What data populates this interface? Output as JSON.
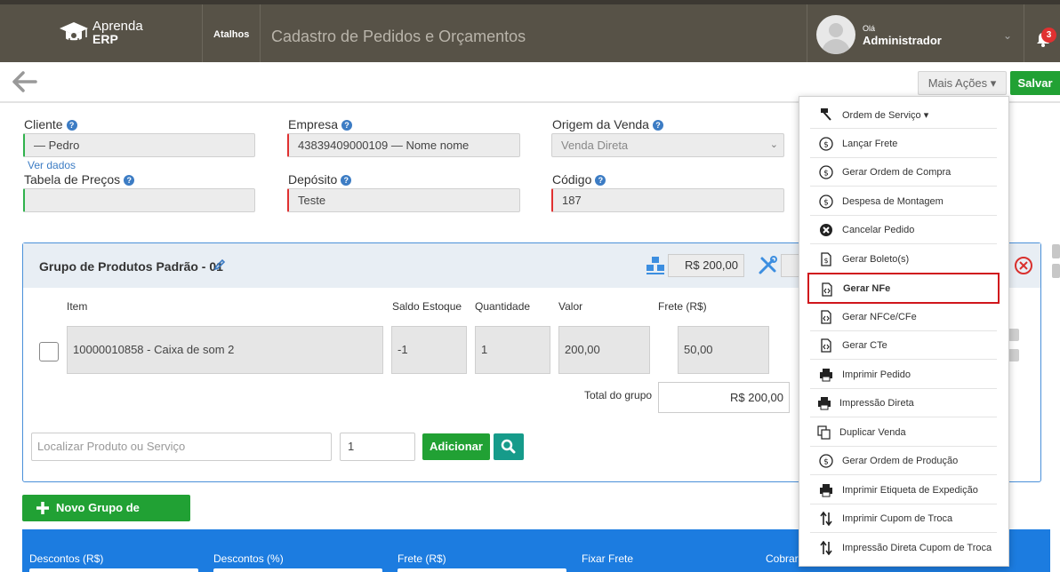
{
  "header": {
    "logo_line1": "Aprenda",
    "logo_line2": "ERP",
    "shortcuts": "Atalhos",
    "title": "Cadastro de Pedidos e Orçamentos",
    "greeting": "Olá",
    "user_name": "Administrador",
    "notifications": "3"
  },
  "actions": {
    "more": "Mais Ações ▾",
    "save": "Salvar"
  },
  "form": {
    "cliente_label": "Cliente",
    "cliente_value": "— Pedro",
    "ver_dados": "Ver dados",
    "empresa_label": "Empresa",
    "empresa_value": "43839409000109 — Nome nome",
    "origem_label": "Origem da Venda",
    "origem_value": "Venda Direta",
    "tabela_label": "Tabela de Preços",
    "tabela_value": "",
    "deposito_label": "Depósito",
    "deposito_value": "Teste",
    "codigo_label": "Código",
    "codigo_value": "187"
  },
  "group": {
    "title": "Grupo de Produtos Padrão - 01",
    "total_badge": "R$ 200,00",
    "columns": {
      "item": "Item",
      "stock": "Saldo Estoque",
      "qty": "Quantidade",
      "value": "Valor",
      "freight": "Frete (R$)"
    },
    "row": {
      "item": "10000010858 - Caixa de som 2",
      "stock": "-1",
      "qty": "1",
      "value": "200,00",
      "freight": "50,00"
    },
    "total_label": "Total do grupo",
    "total_value": "R$ 200,00",
    "search_placeholder": "Localizar Produto ou Serviço",
    "search_qty": "1",
    "add_button": "Adicionar"
  },
  "new_group_button": "Novo Grupo de Produtos",
  "summary": {
    "descontos_rs": "Descontos (R$)",
    "descontos_pct": "Descontos (%)",
    "frete": "Frete (R$)",
    "fixar_frete": "Fixar Frete",
    "cobrar": "Cobrar"
  },
  "menu": {
    "items": [
      {
        "label": "Ordem de Serviço ▾",
        "icon": "hammer-icon"
      },
      {
        "label": "Lançar Frete",
        "icon": "dollar-circle-icon"
      },
      {
        "label": "Gerar Ordem de Compra",
        "icon": "dollar-circle-icon"
      },
      {
        "label": "Despesa de Montagem",
        "icon": "dollar-circle-icon"
      },
      {
        "label": "Cancelar Pedido",
        "icon": "cancel-circle-icon"
      },
      {
        "label": "Gerar Boleto(s)",
        "icon": "invoice-icon"
      },
      {
        "label": "Gerar NFe",
        "icon": "code-file-icon"
      },
      {
        "label": "Gerar NFCe/CFe",
        "icon": "code-file-icon"
      },
      {
        "label": "Gerar CTe",
        "icon": "code-file-icon"
      },
      {
        "label": "Imprimir Pedido",
        "icon": "printer-icon"
      },
      {
        "label": "Impressão Direta",
        "icon": "printer-icon"
      },
      {
        "label": "Duplicar Venda",
        "icon": "copy-icon"
      },
      {
        "label": "Gerar Ordem de Produção",
        "icon": "dollar-circle-icon"
      },
      {
        "label": "Imprimir Etiqueta de Expedição",
        "icon": "printer-icon"
      },
      {
        "label": "Imprimir Cupom de Troca",
        "icon": "swap-arrows-icon"
      },
      {
        "label": "Impressão Direta Cupom de Troca",
        "icon": "swap-arrows-icon"
      }
    ],
    "highlighted_index": 6
  },
  "colors": {
    "topbar": "#575247",
    "primary_green": "#21a134",
    "summary_blue": "#1c7ce0",
    "highlight_red": "#d0161c"
  }
}
